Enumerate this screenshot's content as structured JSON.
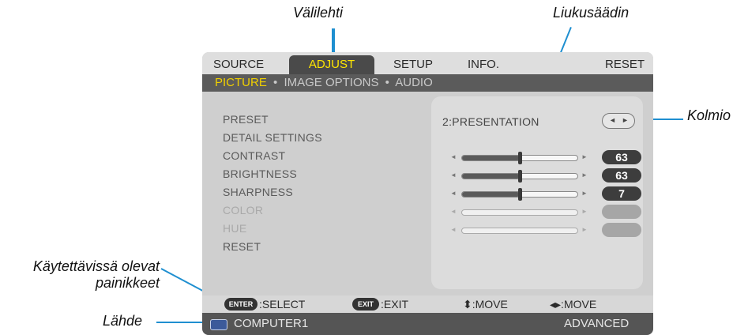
{
  "callouts": {
    "tab": "Välilehti",
    "slider": "Liukusäädin",
    "triangle": "Kolmio",
    "buttons_line1": "Käytettävissä olevat",
    "buttons_line2": "painikkeet",
    "source": "Lähde"
  },
  "tabs": [
    "SOURCE",
    "ADJUST",
    "SETUP",
    "INFO.",
    "RESET"
  ],
  "subtabs": {
    "picture": "PICTURE",
    "image_options": "IMAGE OPTIONS",
    "audio": "AUDIO",
    "sep": "•"
  },
  "items": [
    "PRESET",
    "DETAIL SETTINGS",
    "CONTRAST",
    "BRIGHTNESS",
    "SHARPNESS",
    "COLOR",
    "HUE",
    "RESET"
  ],
  "preset": {
    "value": "2:PRESENTATION",
    "left_arrow": "◄",
    "right_arrow": "►"
  },
  "sliders": [
    {
      "name": "contrast",
      "value": "63",
      "level": 0.5
    },
    {
      "name": "brightness",
      "value": "63",
      "level": 0.5
    },
    {
      "name": "sharpness",
      "value": "7",
      "level": 0.5
    }
  ],
  "footer": {
    "enter_key": "ENTER",
    "enter_label": ":SELECT",
    "exit_key": "EXIT",
    "exit_label": ":EXIT",
    "move_v": "⬍:MOVE",
    "move_h": "◂▸:MOVE"
  },
  "status": {
    "source": "COMPUTER1",
    "mode": "ADVANCED"
  },
  "colors": {
    "accent": "#ffe600",
    "callout_line": "#1f8fd0"
  }
}
